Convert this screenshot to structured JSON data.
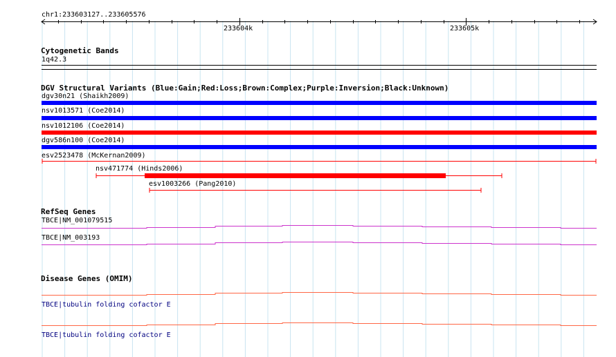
{
  "ruler": {
    "location": "chr1:233603127..233605576",
    "ticks": [
      {
        "label": "233604k",
        "pos": 233604000
      },
      {
        "label": "233605k",
        "pos": 233605000
      }
    ]
  },
  "view": {
    "start": 233603127,
    "end": 233605576
  },
  "tracks": {
    "cytobands": {
      "title": "Cytogenetic Bands",
      "band": "1q42.3"
    },
    "dgv": {
      "title": "DGV Structural Variants (Blue:Gain;Red:Loss;Brown:Complex;Purple:Inversion;Black:Unknown)",
      "features": [
        {
          "name": "dgv30n21 (Shaikh2009)",
          "color": "#0000ff",
          "kind": "bar"
        },
        {
          "name": "nsv1013571 (Coe2014)",
          "color": "#0000ff",
          "kind": "bar"
        },
        {
          "name": "nsv1012106 (Coe2014)",
          "color": "#ff0000",
          "kind": "bar"
        },
        {
          "name": "dgv586n100 (Coe2014)",
          "color": "#0000ff",
          "kind": "bar"
        },
        {
          "name": "esv2523478 (McKernan2009)",
          "color": "#ff0000",
          "kind": "line"
        },
        {
          "name": "nsv471774 (Hinds2006)",
          "color": "#ff0000",
          "kind": "span"
        },
        {
          "name": "esv1003266 (Pang2010)",
          "color": "#ff0000",
          "kind": "line"
        }
      ]
    },
    "refseq": {
      "title": "RefSeq Genes",
      "color": "#cc33cc",
      "genes": [
        {
          "name": "TBCE|NM_001079515"
        },
        {
          "name": "TBCE|NM_003193"
        }
      ]
    },
    "omim": {
      "title": "Disease Genes (OMIM)",
      "color": "#ff6644",
      "genes": [
        {
          "name": "TBCE|tubulin folding cofactor E"
        },
        {
          "name": "TBCE|tubulin folding cofactor E"
        }
      ]
    }
  },
  "colors": {
    "grid": "#c8e4f0",
    "ruler": "#000000",
    "band_line": "#000000"
  }
}
